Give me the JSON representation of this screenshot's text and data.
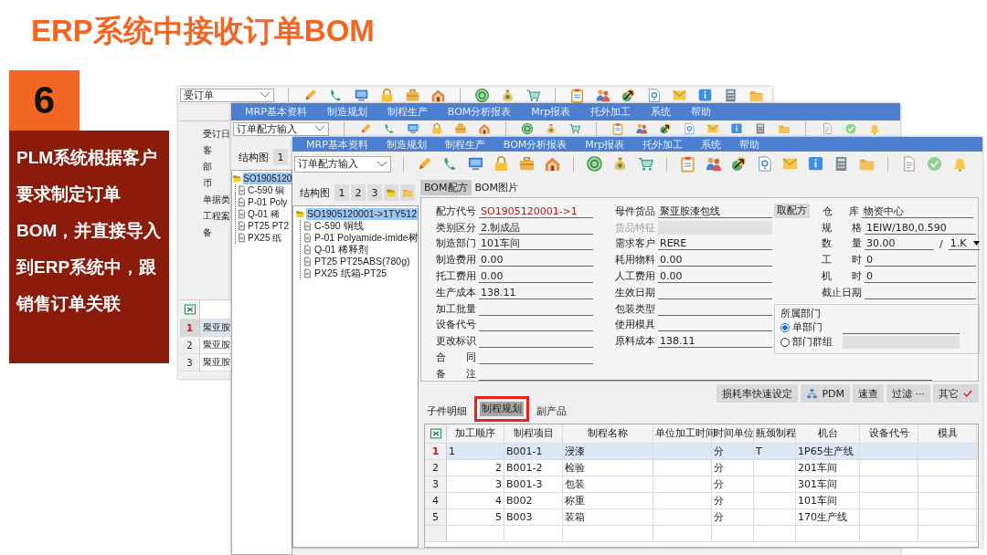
{
  "slide": {
    "title": "ERP系统中接收订单BOM",
    "step_number": "6",
    "description": "PLM系统根据客户要求制定订单BOM，并直接导入到ERP系统中，跟销售订单关联"
  },
  "order_window": {
    "form_dropdown": "受订单",
    "field_labels": [
      "受订日",
      "客",
      "部",
      "币",
      "单据类",
      "工程案",
      "备"
    ],
    "grid_rows": [
      {
        "row_number": "1",
        "cell": "聚亚胺",
        "selected": true
      },
      {
        "row_number": "2",
        "cell": "聚亚胺",
        "selected": false
      },
      {
        "row_number": "3",
        "cell": "聚亚胺",
        "selected": false
      }
    ]
  },
  "bom_window_back": {
    "menu": [
      "MRP基本资料",
      "制造规划",
      "制程生产",
      "BOM分析报表",
      "Mrp报表",
      "托外加工",
      "系统",
      "帮助"
    ],
    "form_dropdown": "订单配方输入",
    "tree_tab_label": "结构图",
    "tree_tabs": [
      {
        "label": "1",
        "selected": false
      }
    ],
    "tree": {
      "label": "SO1905120",
      "selected": true,
      "children": [
        {
          "label": "C-590 铜",
          "selected": false
        },
        {
          "label": "P-01 Poly",
          "selected": false
        },
        {
          "label": "Q-01 稀",
          "selected": false
        },
        {
          "label": "PT25 PT2",
          "selected": false
        },
        {
          "label": "PX25 纸",
          "selected": false
        }
      ]
    }
  },
  "bom_window": {
    "menu": [
      "MRP基本资料",
      "制造规划",
      "制程生产",
      "BOM分析报表",
      "Mrp报表",
      "托外加工",
      "系统",
      "帮助"
    ],
    "form_dropdown": "订单配方输入",
    "tree_tab_label": "结构图",
    "tree_tabs": [
      {
        "label": "1",
        "selected": false
      },
      {
        "label": "2",
        "selected": false
      },
      {
        "label": "3",
        "selected": false
      }
    ],
    "tree": {
      "label": "SO1905120001->1TY512",
      "selected": true,
      "children": [
        {
          "label": "C-590 铜线",
          "selected": false
        },
        {
          "label": "P-01 Polyamide-imide树",
          "selected": false
        },
        {
          "label": "Q-01 稀释剂",
          "selected": false
        },
        {
          "label": "PT25 PT25ABS(780g)",
          "selected": false
        },
        {
          "label": "PX25 纸箱-PT25",
          "selected": false
        }
      ]
    },
    "tabs": [
      {
        "label": "BOM配方",
        "selected": true
      },
      {
        "label": "BOM图片",
        "selected": false
      }
    ],
    "form": {
      "left_fields": [
        {
          "label": "配方代号",
          "value": "SO1905120001->1",
          "kind": "code"
        },
        {
          "label": "类别区分",
          "value": "2.制成品",
          "kind": "text"
        },
        {
          "label": "制造部门",
          "value": "101车间",
          "kind": "text"
        },
        {
          "label": "制造费用",
          "value": "0.00",
          "kind": "text"
        },
        {
          "label": "托工费用",
          "value": "0.00",
          "kind": "text"
        },
        {
          "label": "生产成本",
          "value": "138.11",
          "kind": "text"
        },
        {
          "label": "加工批量",
          "kind": "text"
        },
        {
          "label": "设备代号",
          "kind": "text"
        },
        {
          "label": "更改标识",
          "kind": "text"
        },
        {
          "label": "合 同",
          "kind": "text"
        }
      ],
      "middle_fields": [
        {
          "label": "母件货品",
          "value": "聚亚胺漆包线",
          "kind": "text"
        },
        {
          "label": "货品特征",
          "kind": "locked"
        },
        {
          "label": "需求客户",
          "value": "RERE",
          "kind": "text"
        },
        {
          "label": "耗用物料",
          "value": "0.00",
          "kind": "text"
        },
        {
          "label": "人工费用",
          "value": "0.00",
          "kind": "text"
        },
        {
          "label": "生效日期",
          "kind": "text"
        },
        {
          "label": "包装类型",
          "kind": "text"
        },
        {
          "label": "使用模具",
          "kind": "text"
        },
        {
          "label": "原料成本",
          "value": "138.11",
          "kind": "text"
        }
      ],
      "fetch_button": "取配方",
      "right_fields": [
        {
          "label": "仓库",
          "value": "物资中心",
          "kind": "text"
        },
        {
          "label": "规 格",
          "value": "1EIW/180,0.590",
          "kind": "text"
        },
        {
          "label": "数 量",
          "value": "30.00",
          "kind": "quantity",
          "separator": "/",
          "unit": "1.K"
        },
        {
          "label": "工 时",
          "value": "0",
          "kind": "text"
        },
        {
          "label": "机 时",
          "value": "0",
          "kind": "text"
        },
        {
          "label": "截止日期",
          "kind": "text"
        }
      ],
      "remark_label": "备 注",
      "department_group": {
        "title": "所属部门",
        "options": [
          {
            "label": "单部门",
            "selected": true
          },
          {
            "label": "部门群组",
            "selected": false
          }
        ]
      }
    },
    "action_buttons": [
      {
        "label": "损耗率快速设定",
        "kind": "plain"
      },
      {
        "label": "PDM",
        "kind": "hierarchy"
      },
      {
        "label": "速查",
        "kind": "plain"
      },
      {
        "label": "过滤 ···",
        "kind": "plain"
      },
      {
        "label": "其它",
        "kind": "check"
      }
    ],
    "detail_tabs": [
      {
        "label": "子件明细",
        "selected": false,
        "framed": false
      },
      {
        "label": "制程规划",
        "selected": true,
        "framed": true
      },
      {
        "label": "副产品",
        "selected": false,
        "framed": false
      }
    ],
    "process_grid": {
      "columns": [
        "加工顺序",
        "制程项目",
        "制程名称",
        "单位加工时间",
        "时间单位",
        "瓶颈制程",
        "机台",
        "设备代号",
        "模具"
      ],
      "rows": [
        {
          "row_number": "1",
          "selected": true,
          "sequence": "1",
          "code": "B001-1",
          "name": "浸漆",
          "unit": "分",
          "bottleneck": "T",
          "machine": "1P65生产线"
        },
        {
          "row_number": "2",
          "selected": false,
          "sequence": "2",
          "code": "B001-2",
          "name": "检验",
          "unit": "分",
          "machine": "201车间"
        },
        {
          "row_number": "3",
          "selected": false,
          "sequence": "3",
          "code": "B001-3",
          "name": "包装",
          "unit": "分",
          "machine": "301车间"
        },
        {
          "row_number": "4",
          "selected": false,
          "sequence": "4",
          "code": "B002",
          "name": "称重",
          "unit": "分",
          "machine": "101车间"
        },
        {
          "row_number": "5",
          "selected": false,
          "sequence": "5",
          "code": "B003",
          "name": "装箱",
          "unit": "分",
          "machine": "170生产线"
        }
      ]
    }
  }
}
